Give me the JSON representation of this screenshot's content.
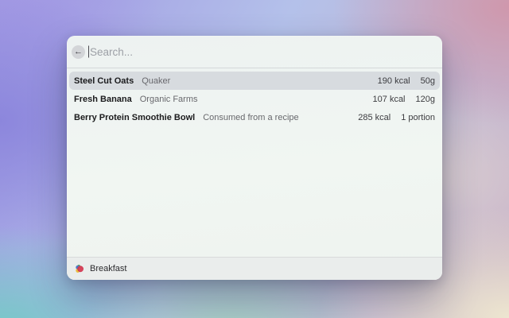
{
  "window": {
    "search": {
      "back_icon": "arrow-left",
      "back_glyph": "←",
      "placeholder": "Search..."
    },
    "results": [
      {
        "name": "Steel Cut Oats",
        "brand": "Quaker",
        "kcal": "190 kcal",
        "amount": "50g"
      },
      {
        "name": "Fresh Banana",
        "brand": "Organic Farms",
        "kcal": "107 kcal",
        "amount": "120g"
      },
      {
        "name": "Berry Protein Smoothie Bowl",
        "brand": "Consumed from a recipe",
        "kcal": "285 kcal",
        "amount": "1 portion"
      }
    ],
    "selected_index": 0,
    "footer": {
      "app_icon": "food-app-icon",
      "label": "Breakfast"
    },
    "colors": {
      "selected_row_bg": "#d7dbdf",
      "primary_text": "#1b1b1d",
      "secondary_text": "#68686d",
      "value_text": "#3c3c40",
      "placeholder_text": "#9da0a6",
      "icon_red": "#cf3a52",
      "icon_blue": "#4b79c8",
      "icon_yellow": "#e9bc3f",
      "icon_green": "#57a553"
    }
  },
  "background": {
    "top_left": "#a39ae4",
    "top_center": "#b4c1ea",
    "top_right": "#d096aa",
    "left_middle": "#8b85dc",
    "bottom_left": "#74cac6",
    "bottom_center": "#a2d2be",
    "bottom_right": "#eee7d0"
  }
}
